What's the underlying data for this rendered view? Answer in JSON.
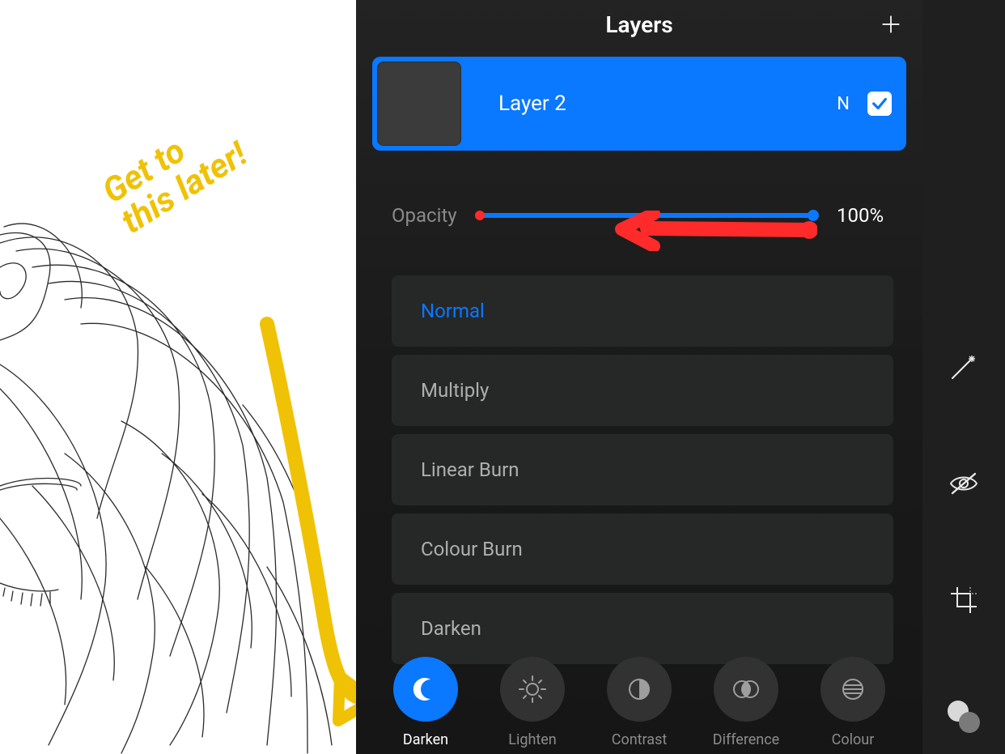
{
  "panel": {
    "title": "Layers"
  },
  "layer": {
    "name": "Layer 2",
    "blend_short": "N",
    "visible": true
  },
  "opacity": {
    "label": "Opacity",
    "value_text": "100%",
    "value": 100
  },
  "blend_modes": [
    {
      "label": "Normal",
      "selected": true
    },
    {
      "label": "Multiply",
      "selected": false
    },
    {
      "label": "Linear Burn",
      "selected": false
    },
    {
      "label": "Colour Burn",
      "selected": false
    },
    {
      "label": "Darken",
      "selected": false
    }
  ],
  "categories": [
    {
      "label": "Darken",
      "icon": "moon",
      "active": true
    },
    {
      "label": "Lighten",
      "icon": "sun",
      "active": false
    },
    {
      "label": "Contrast",
      "icon": "half-circle",
      "active": false
    },
    {
      "label": "Difference",
      "icon": "overlap",
      "active": false
    },
    {
      "label": "Colour",
      "icon": "lines",
      "active": false
    }
  ],
  "right_tools": [
    {
      "name": "magic-wand",
      "icon": "wand"
    },
    {
      "name": "visibility",
      "icon": "eye-off"
    },
    {
      "name": "crop",
      "icon": "crop"
    },
    {
      "name": "color",
      "icon": "swatch"
    }
  ],
  "annotation": {
    "line1": "Get to",
    "line2": "this later!"
  }
}
